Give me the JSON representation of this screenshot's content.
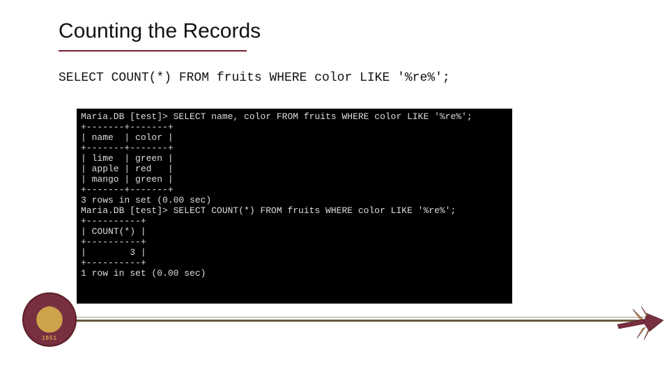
{
  "title": "Counting the Records",
  "query": "SELECT COUNT(*) FROM fruits WHERE color LIKE '%re%';",
  "terminal_lines": [
    "Maria.DB [test]> SELECT name, color FROM fruits WHERE color LIKE '%re%';",
    "+-------+-------+",
    "| name  | color |",
    "+-------+-------+",
    "| lime  | green |",
    "| apple | red   |",
    "| mango | green |",
    "+-------+-------+",
    "3 rows in set (0.00 sec)",
    "",
    "Maria.DB [test]> SELECT COUNT(*) FROM fruits WHERE color LIKE '%re%';",
    "+----------+",
    "| COUNT(*) |",
    "+----------+",
    "|        3 |",
    "+----------+",
    "1 row in set (0.00 sec)"
  ],
  "seal_year": "1851"
}
